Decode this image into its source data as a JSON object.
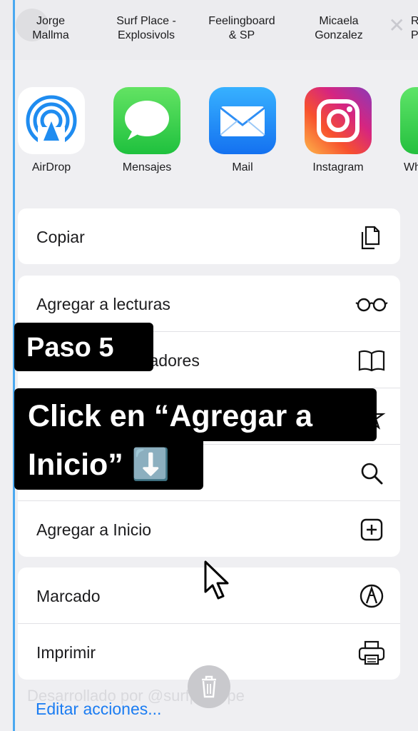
{
  "contacts": [
    {
      "name": "Jorge\nMallma"
    },
    {
      "name": "Surf Place -\nExplosivols"
    },
    {
      "name": "Feelingboard\n& SP"
    },
    {
      "name": "Micaela\nGonzalez"
    },
    {
      "name": "R\nP"
    }
  ],
  "apps": [
    {
      "label": "AirDrop",
      "icon": "airdrop-icon"
    },
    {
      "label": "Mensajes",
      "icon": "messages-icon"
    },
    {
      "label": "Mail",
      "icon": "mail-icon"
    },
    {
      "label": "Instagram",
      "icon": "instagram-icon"
    },
    {
      "label": "Wh",
      "icon": "whatsapp-icon"
    }
  ],
  "actions": {
    "copy": "Copiar",
    "reading_list": "Agregar a lecturas",
    "bookmarks": "Agregar a marcadores",
    "add_home": "Agregar a Inicio",
    "markup": "Marcado",
    "print": "Imprimir"
  },
  "edit_actions": "Editar acciones...",
  "ghost_text": "Desarrollado por @surfplacepe",
  "overlay": {
    "step": "Paso 5",
    "line1": "Click en “Agregar a",
    "line2": "Inicio” ⬇️"
  },
  "colors": {
    "accent": "#1a7cf2",
    "frame": "#4aa8f0"
  }
}
